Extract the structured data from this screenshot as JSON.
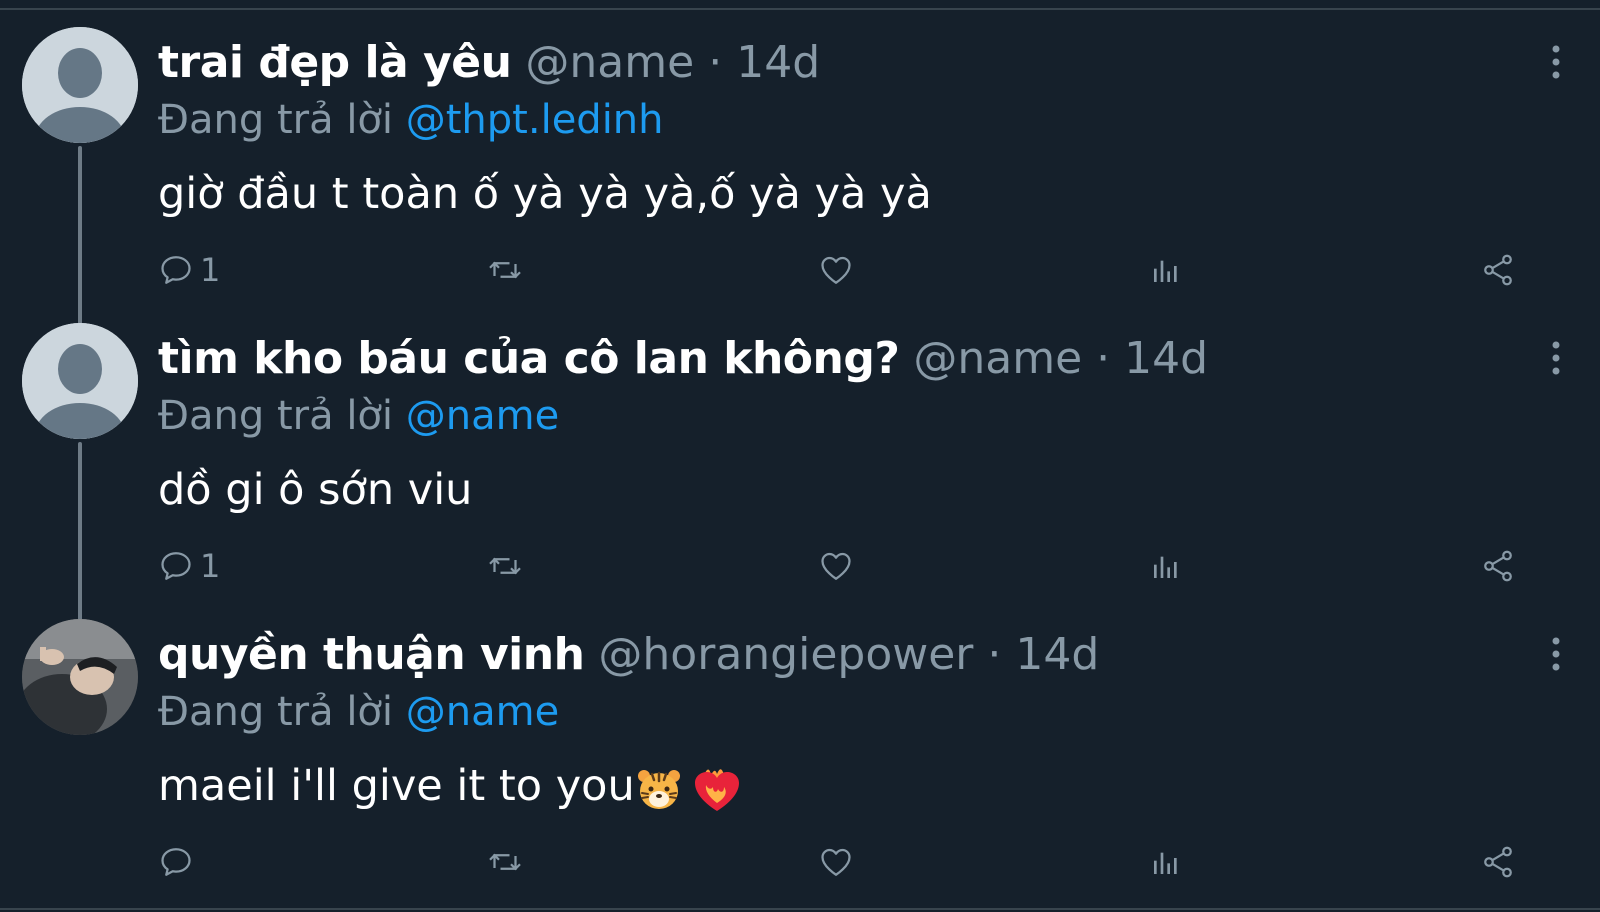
{
  "colors": {
    "background": "#15202b",
    "secondary_text": "#8899a6",
    "link": "#1d9bf0",
    "divider": "#38444d"
  },
  "tweets": [
    {
      "display_name": "trai đẹp là yêu",
      "handle": "@name",
      "separator": "·",
      "time": "14d",
      "reply_label": "Đang trả lời",
      "reply_target": "@thpt.ledinh",
      "text": "giờ đầu t toàn ố yà yà yà,ố yà yà yà",
      "reply_count": "1",
      "avatar": "default-avatar-icon"
    },
    {
      "display_name": "tìm kho báu của cô lan không?",
      "handle": "@name",
      "separator": "·",
      "time": "14d",
      "reply_label": "Đang trả lời",
      "reply_target": "@name",
      "text": "dồ gi ô sớn viu",
      "reply_count": "1",
      "avatar": "default-avatar-icon"
    },
    {
      "display_name": "quyền thuận vinh",
      "handle": "@horangiepower",
      "separator": "·",
      "time": "14d",
      "reply_label": "Đang trả lời",
      "reply_target": "@name",
      "text": "maeil i'll give it to you",
      "reply_count": "",
      "avatar": "profile-photo",
      "emojis": [
        "tiger-face-emoji",
        "heart-on-fire-emoji"
      ]
    }
  ],
  "icons": {
    "reply": "reply-icon",
    "retweet": "retweet-icon",
    "like": "heart-icon",
    "views": "analytics-icon",
    "share": "share-icon",
    "more": "more-vertical-icon"
  }
}
